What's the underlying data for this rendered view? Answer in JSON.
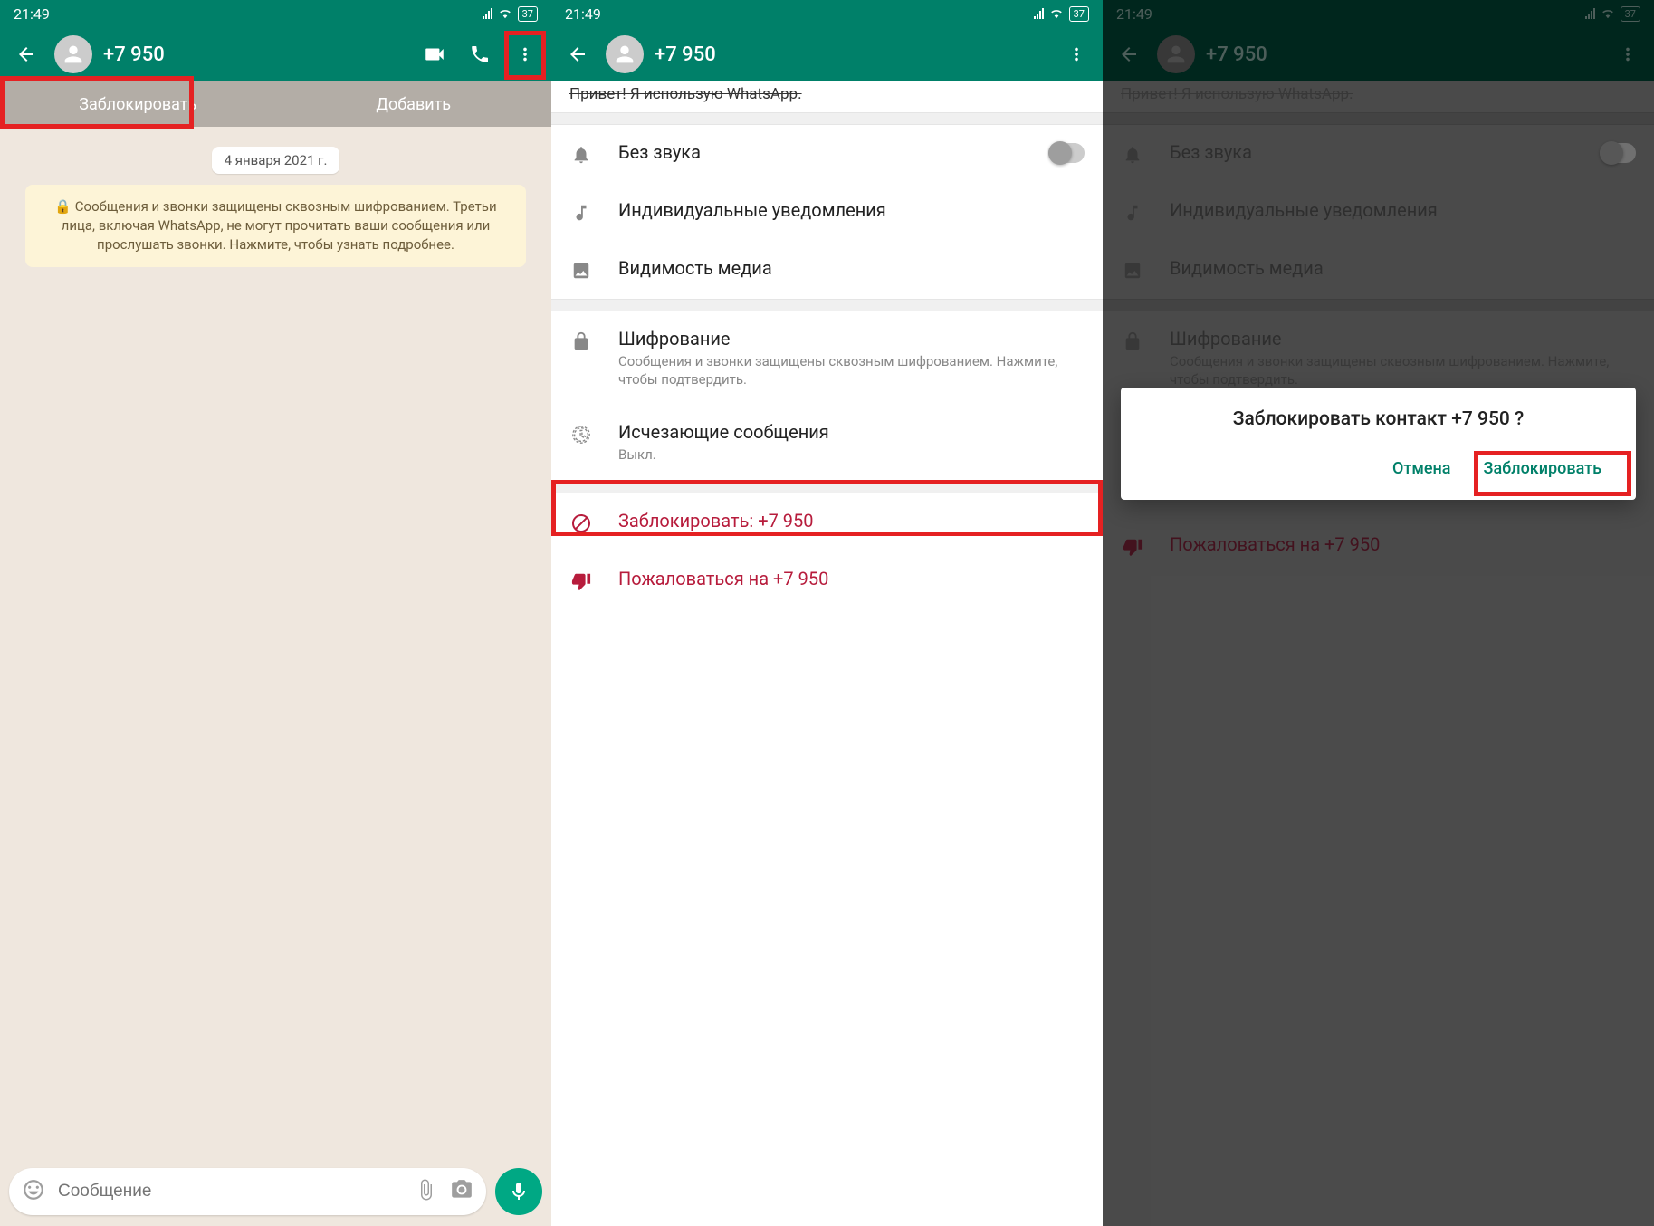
{
  "status": {
    "time": "21:49",
    "battery": "37"
  },
  "contact": {
    "number": "+7 950"
  },
  "pane1": {
    "block": "Заблокировать",
    "add": "Добавить",
    "date": "4 января 2021 г.",
    "encryption_notice": "🔒 Сообщения и звонки защищены сквозным шифрованием. Третьи лица, включая WhatsApp, не могут прочитать ваши сообщения или прослушать звонки. Нажмите, чтобы узнать подробнее.",
    "compose_placeholder": "Сообщение"
  },
  "settings": {
    "head_partial": "Привет! Я использую WhatsApp.",
    "mute": "Без звука",
    "custom_notif": "Индивидуальные уведомления",
    "media_vis": "Видимость медиа",
    "encryption": "Шифрование",
    "encryption_sub": "Сообщения и звонки защищены сквозным шифрованием. Нажмите, чтобы подтвердить.",
    "disappearing": "Исчезающие сообщения",
    "disappearing_sub": "Выкл.",
    "block": "Заблокировать: +7 950",
    "report": "Пожаловаться на +7 950"
  },
  "dialog": {
    "title": "Заблокировать контакт +7 950 ?",
    "cancel": "Отмена",
    "confirm": "Заблокировать"
  }
}
